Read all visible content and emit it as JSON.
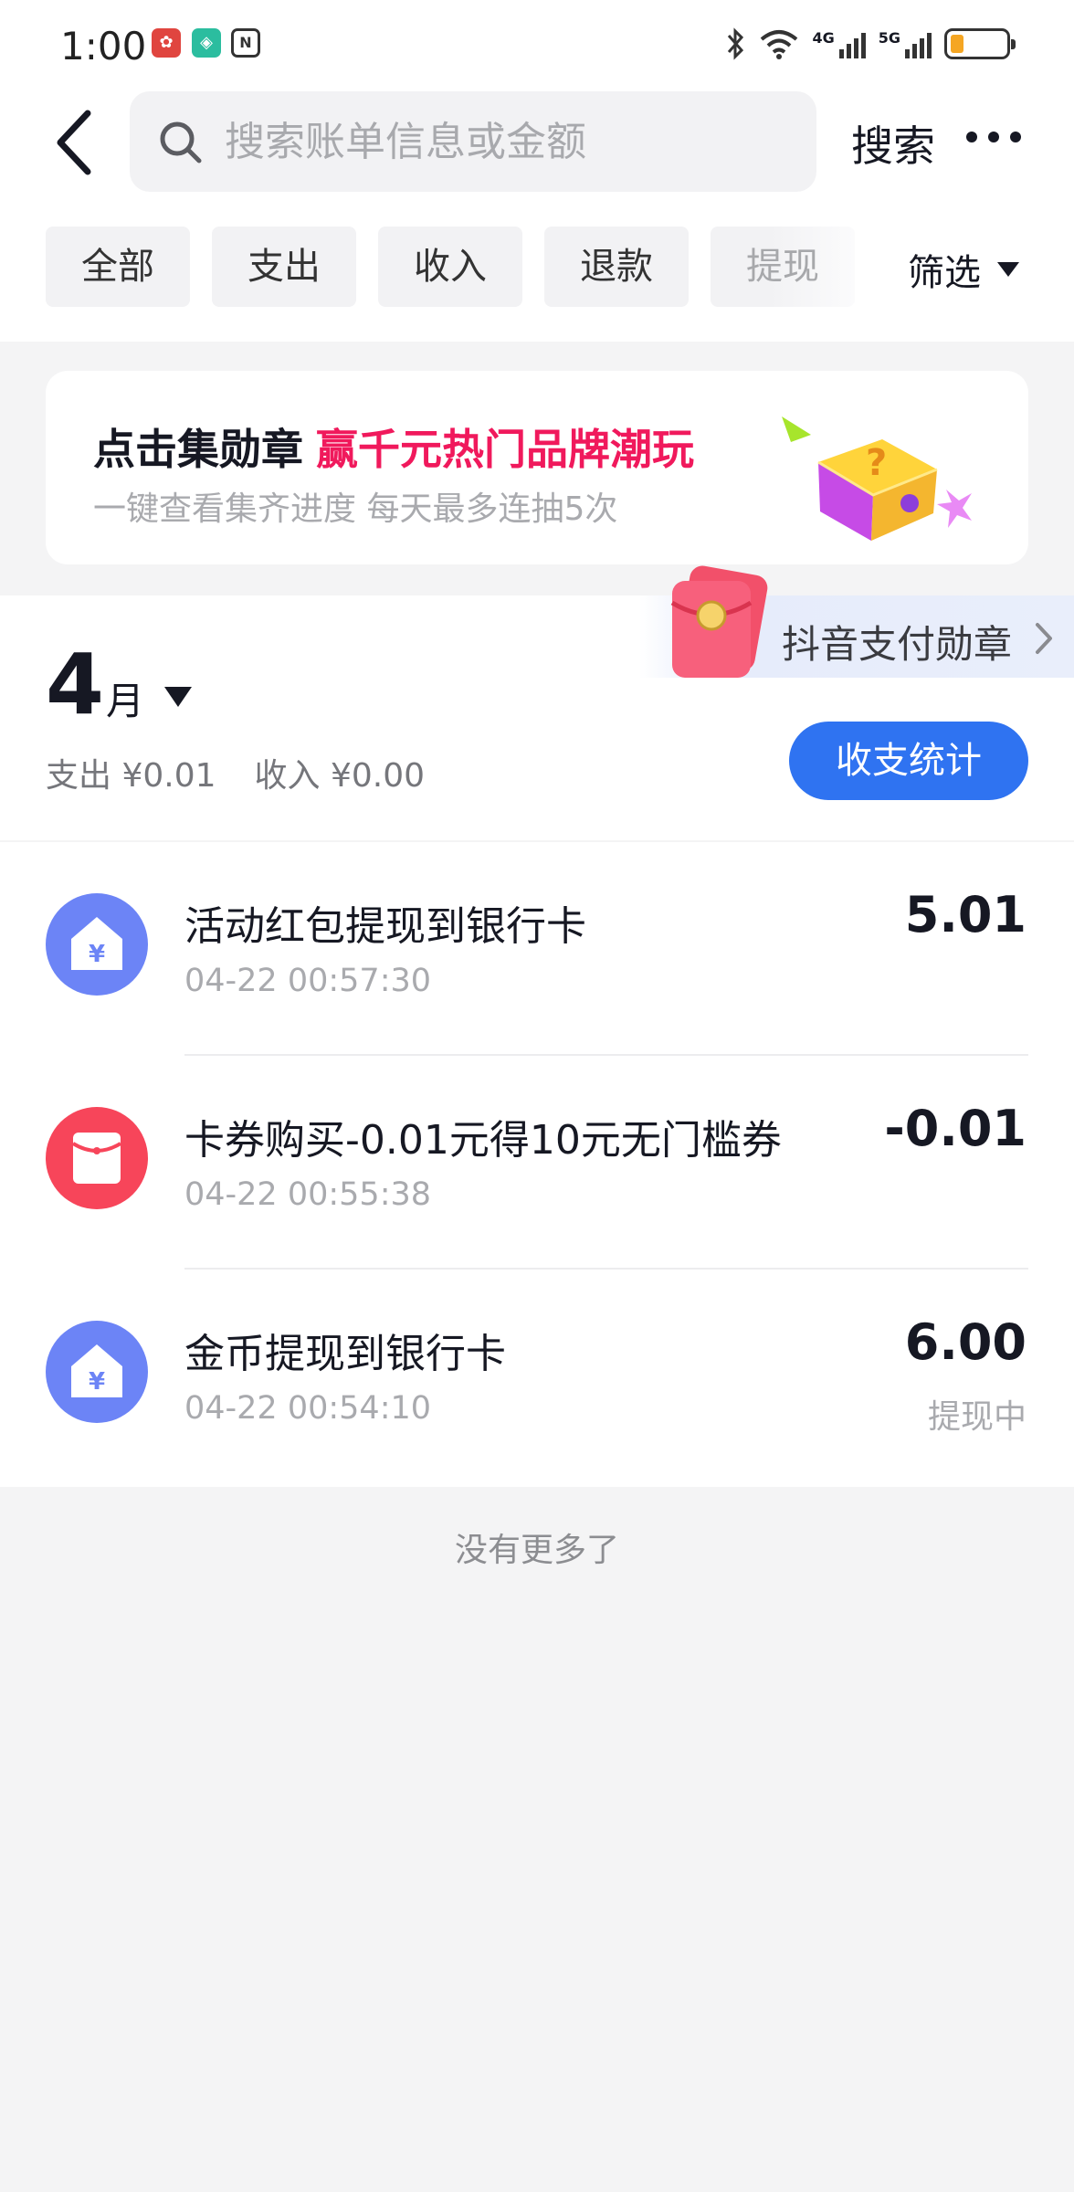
{
  "status_bar": {
    "time": "1:00",
    "signal1_label": "4G",
    "signal2_label": "5G"
  },
  "header": {
    "search_placeholder": "搜索账单信息或金额",
    "search_button": "搜索"
  },
  "filters": {
    "chips": [
      "全部",
      "支出",
      "收入",
      "退款",
      "提现"
    ],
    "filter_label": "筛选"
  },
  "banner": {
    "title": "点击集勋章",
    "highlight": "赢千元热门品牌潮玩",
    "subtitle": "一键查看集齐进度 每天最多连抽5次"
  },
  "month": {
    "number": "4",
    "unit": "月",
    "expense": "支出 ¥0.01",
    "income": "收入 ¥0.00",
    "stats_button": "收支统计",
    "medal_label": "抖音支付勋章"
  },
  "transactions": [
    {
      "title": "活动红包提现到银行卡",
      "time": "04-22 00:57:30",
      "amount": "5.01",
      "status": "",
      "icon": "withdraw-house-icon",
      "color": "#6c84f6"
    },
    {
      "title": "卡券购买-0.01元得10元无门槛券",
      "time": "04-22 00:55:38",
      "amount": "-0.01",
      "status": "",
      "icon": "red-envelope-icon",
      "color": "#f7455a"
    },
    {
      "title": "金币提现到银行卡",
      "time": "04-22 00:54:10",
      "amount": "6.00",
      "status": "提现中",
      "icon": "withdraw-house-icon",
      "color": "#6c84f6"
    }
  ],
  "footer": {
    "no_more": "没有更多了"
  },
  "colors": {
    "accent_blue": "#2f73f1",
    "highlight_red": "#f0195c"
  }
}
